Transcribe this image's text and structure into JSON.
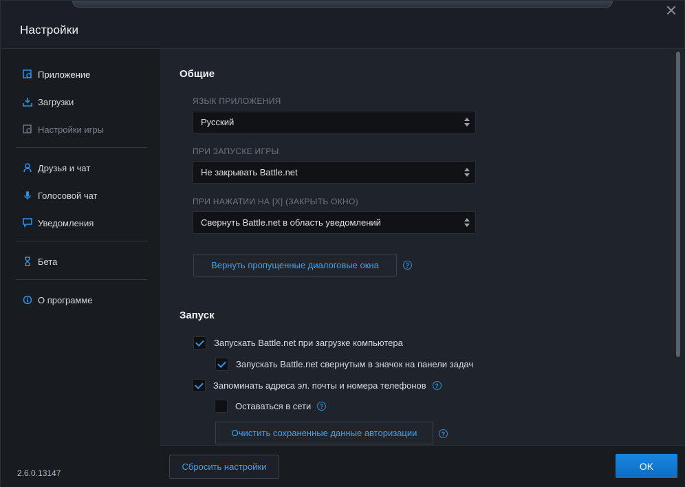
{
  "window": {
    "title": "Настройки"
  },
  "sidebar": {
    "items": [
      {
        "label": "Приложение",
        "icon": "app-settings-icon"
      },
      {
        "label": "Загрузки",
        "icon": "download-icon"
      },
      {
        "label": "Настройки игры",
        "icon": "game-settings-icon"
      },
      {
        "label": "Друзья и чат",
        "icon": "friends-icon"
      },
      {
        "label": "Голосовой чат",
        "icon": "microphone-icon"
      },
      {
        "label": "Уведомления",
        "icon": "notification-icon"
      },
      {
        "label": "Бета",
        "icon": "beta-flask-icon"
      },
      {
        "label": "О программе",
        "icon": "info-icon"
      }
    ],
    "version": "2.6.0.13147"
  },
  "general": {
    "title": "Общие",
    "language_label": "ЯЗЫК ПРИЛОЖЕНИЯ",
    "language_value": "Русский",
    "launch_label": "ПРИ ЗАПУСКЕ ИГРЫ",
    "launch_value": "Не закрывать Battle.net",
    "close_label": "ПРИ НАЖАТИИ НА [X] (ЗАКРЫТЬ ОКНО)",
    "close_value": "Свернуть Battle.net в область уведомлений",
    "restore_dialogs_button": "Вернуть пропущенные диалоговые окна"
  },
  "startup": {
    "title": "Запуск",
    "options": [
      {
        "label": "Запускать Battle.net при загрузке компьютера",
        "checked": true
      },
      {
        "label": "Запускать Battle.net свернутым в значок на панели задач",
        "checked": true
      },
      {
        "label": "Запоминать адреса эл. почты и номера телефонов",
        "checked": true
      },
      {
        "label": "Оставаться в сети",
        "checked": false
      }
    ],
    "clear_auth_button": "Очистить сохраненные данные авторизации"
  },
  "footer": {
    "reset_button": "Сбросить настройки",
    "ok_button": "OK"
  },
  "colors": {
    "accent": "#2f93ea",
    "link": "#3fa3f0",
    "ok_button": "#1479d4"
  }
}
